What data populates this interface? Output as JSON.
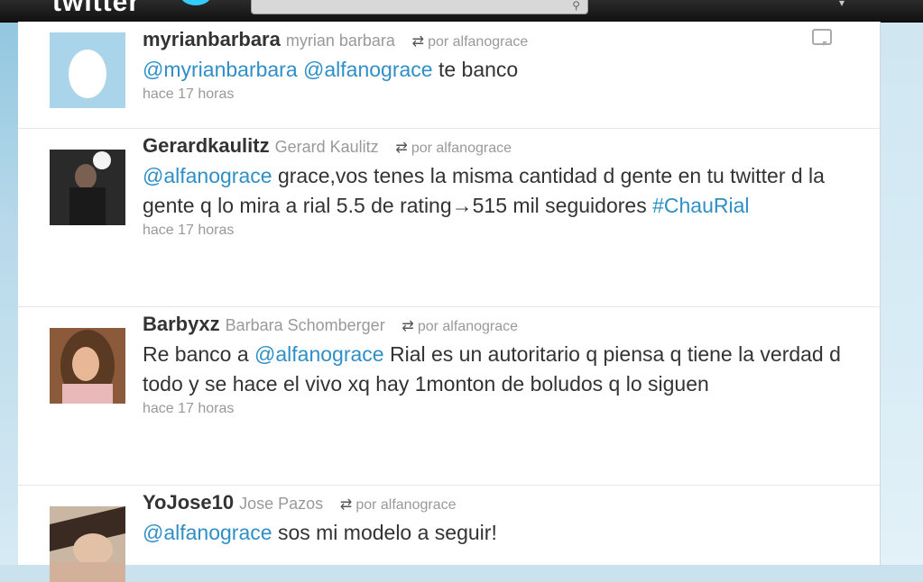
{
  "header": {
    "logo_text": "twitter",
    "search_placeholder": "",
    "search_icon": "search-icon"
  },
  "tweets": [
    {
      "screen_name": "myrianbarbara",
      "real_name": "myrian barbara",
      "retweeted_by": "por alfanograce",
      "segments": [
        {
          "type": "mention",
          "text": "@myrianbarbara"
        },
        {
          "type": "text",
          "text": " "
        },
        {
          "type": "mention",
          "text": "@alfanograce"
        },
        {
          "type": "text",
          "text": " te banco"
        }
      ],
      "time": "hace 17 horas",
      "avatar": "egg-avatar"
    },
    {
      "screen_name": "Gerardkaulitz",
      "real_name": "Gerard Kaulitz",
      "retweeted_by": "por alfanograce",
      "segments": [
        {
          "type": "mention",
          "text": "@alfanograce"
        },
        {
          "type": "text",
          "text": " grace,vos tenes la misma cantidad d gente en tu twitter d la gente q lo mira a rial 5.5 de rating→515 mil seguidores "
        },
        {
          "type": "hashtag",
          "text": "#ChauRial"
        }
      ],
      "time": "hace 17 horas",
      "avatar": "photo-avatar"
    },
    {
      "screen_name": "Barbyxz",
      "real_name": "Barbara Schomberger",
      "retweeted_by": "por alfanograce",
      "segments": [
        {
          "type": "text",
          "text": "Re banco a "
        },
        {
          "type": "mention",
          "text": "@alfanograce"
        },
        {
          "type": "text",
          "text": " Rial es un autoritario q piensa q tiene la verdad d todo y se hace el vivo xq hay 1monton de boludos q lo siguen"
        }
      ],
      "time": "hace 17 horas",
      "avatar": "photo-avatar"
    },
    {
      "screen_name": "YoJose10",
      "real_name": "Jose Pazos",
      "retweeted_by": "por alfanograce",
      "segments": [
        {
          "type": "mention",
          "text": "@alfanograce"
        },
        {
          "type": "text",
          "text": " sos mi modelo a seguir!"
        }
      ],
      "time": "",
      "avatar": "photo-avatar"
    }
  ],
  "colors": {
    "link": "#2f8fc6",
    "text": "#333333",
    "muted": "#999999"
  }
}
